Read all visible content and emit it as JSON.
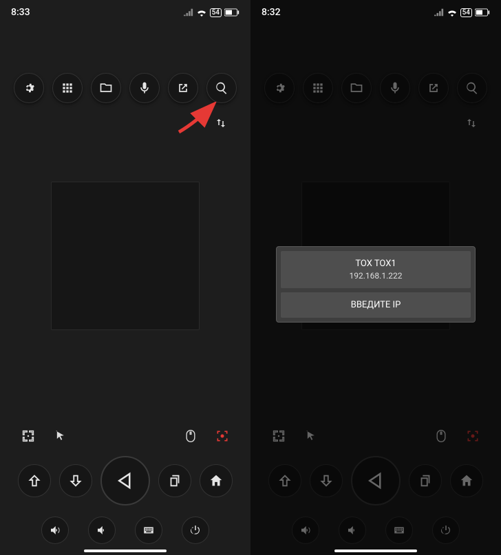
{
  "left": {
    "status": {
      "time": "8:33",
      "battery": "54"
    }
  },
  "right": {
    "status": {
      "time": "8:32",
      "battery": "54"
    },
    "modal": {
      "device_name": "TOX TOX1",
      "device_ip": "192.168.1.222",
      "enter_ip_label": "ВВЕДИТЕ IP"
    }
  },
  "icons": {
    "settings": "gear-icon",
    "apps": "grid-icon",
    "files": "folder-icon",
    "mic": "mic-icon",
    "open_external": "open-external-icon",
    "search": "search-icon",
    "sort": "sort-icon",
    "fullscreen": "fullscreen-icon",
    "cursor": "cursor-icon",
    "mouse": "mouse-icon",
    "capture": "capture-icon",
    "up": "arrow-up-icon",
    "down": "arrow-down-icon",
    "back": "back-triangle-icon",
    "copy": "copy-icon",
    "home": "home-icon",
    "vol_up": "volume-up-icon",
    "vol_down": "volume-down-icon",
    "keyboard": "keyboard-icon",
    "power": "power-icon"
  }
}
